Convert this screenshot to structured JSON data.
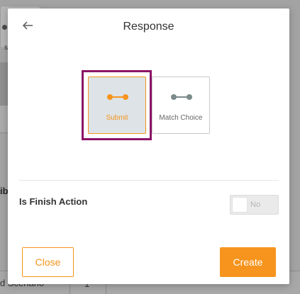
{
  "background": {
    "chip_text": "s",
    "side_label": "ib",
    "footer_text": "d Scenario",
    "footer_box_text": "1"
  },
  "modal": {
    "title": "Response",
    "back_icon": "arrow-left-icon",
    "options": [
      {
        "label": "Submit",
        "icon": "connector-icon",
        "selected": true,
        "color": "#f7941d"
      },
      {
        "label": "Match Choice",
        "icon": "connector-icon",
        "selected": false,
        "color": "#7b8a8a"
      }
    ],
    "finish_action": {
      "label": "Is Finish Action",
      "toggle_state": "No"
    },
    "buttons": {
      "close": "Close",
      "create": "Create"
    }
  },
  "colors": {
    "accent": "#f7941d",
    "highlight": "#8b1466"
  }
}
